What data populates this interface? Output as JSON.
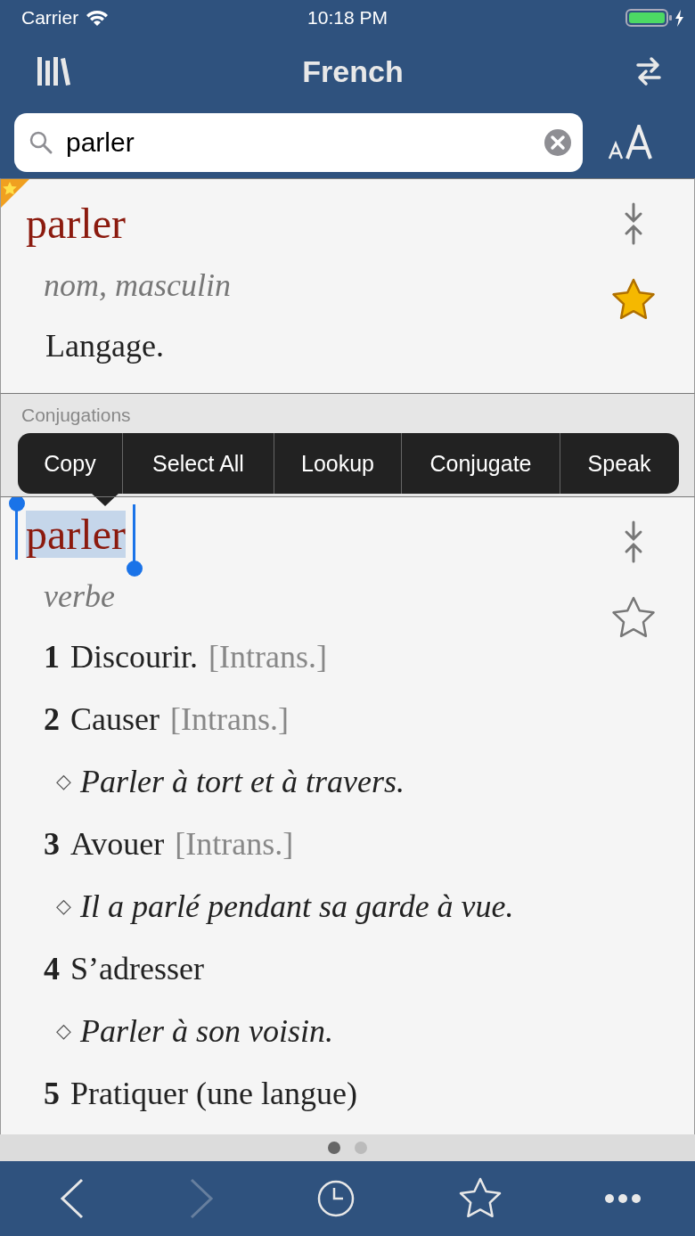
{
  "status_bar": {
    "carrier": "Carrier",
    "time": "10:18 PM"
  },
  "nav": {
    "title": "French"
  },
  "search": {
    "value": "parler"
  },
  "entries": [
    {
      "headword": "parler",
      "pos": "nom, masculin",
      "favorite": true,
      "highlighted": false,
      "senses": [
        {
          "kind": "definition",
          "text": "Langage."
        }
      ]
    },
    {
      "headword": "parler",
      "pos": "verbe",
      "favorite": false,
      "highlighted": true,
      "senses": [
        {
          "kind": "sense",
          "number": "1",
          "text": "Discourir.",
          "tag": "[Intrans.]"
        },
        {
          "kind": "sense",
          "number": "2",
          "text": "Causer",
          "tag": "[Intrans.]"
        },
        {
          "kind": "example",
          "bullet": "◇",
          "text": "Parler à tort et à travers."
        },
        {
          "kind": "sense",
          "number": "3",
          "text": "Avouer",
          "tag": "[Intrans.]"
        },
        {
          "kind": "example",
          "bullet": "◇",
          "text": "Il a parlé pendant sa garde à vue."
        },
        {
          "kind": "sense",
          "number": "4",
          "text": "S’adresser"
        },
        {
          "kind": "example",
          "bullet": "◇",
          "text": "Parler à son voisin."
        },
        {
          "kind": "sense",
          "number": "5",
          "text": "Pratiquer (une langue)"
        }
      ]
    }
  ],
  "section": {
    "label": "Conjugations"
  },
  "context_menu": [
    "Copy",
    "Select All",
    "Lookup",
    "Conjugate",
    "Speak"
  ],
  "pages": [
    {
      "selected": true
    },
    {
      "selected": false
    }
  ],
  "toolbar": {
    "back_disabled": false,
    "forward_disabled": true
  }
}
